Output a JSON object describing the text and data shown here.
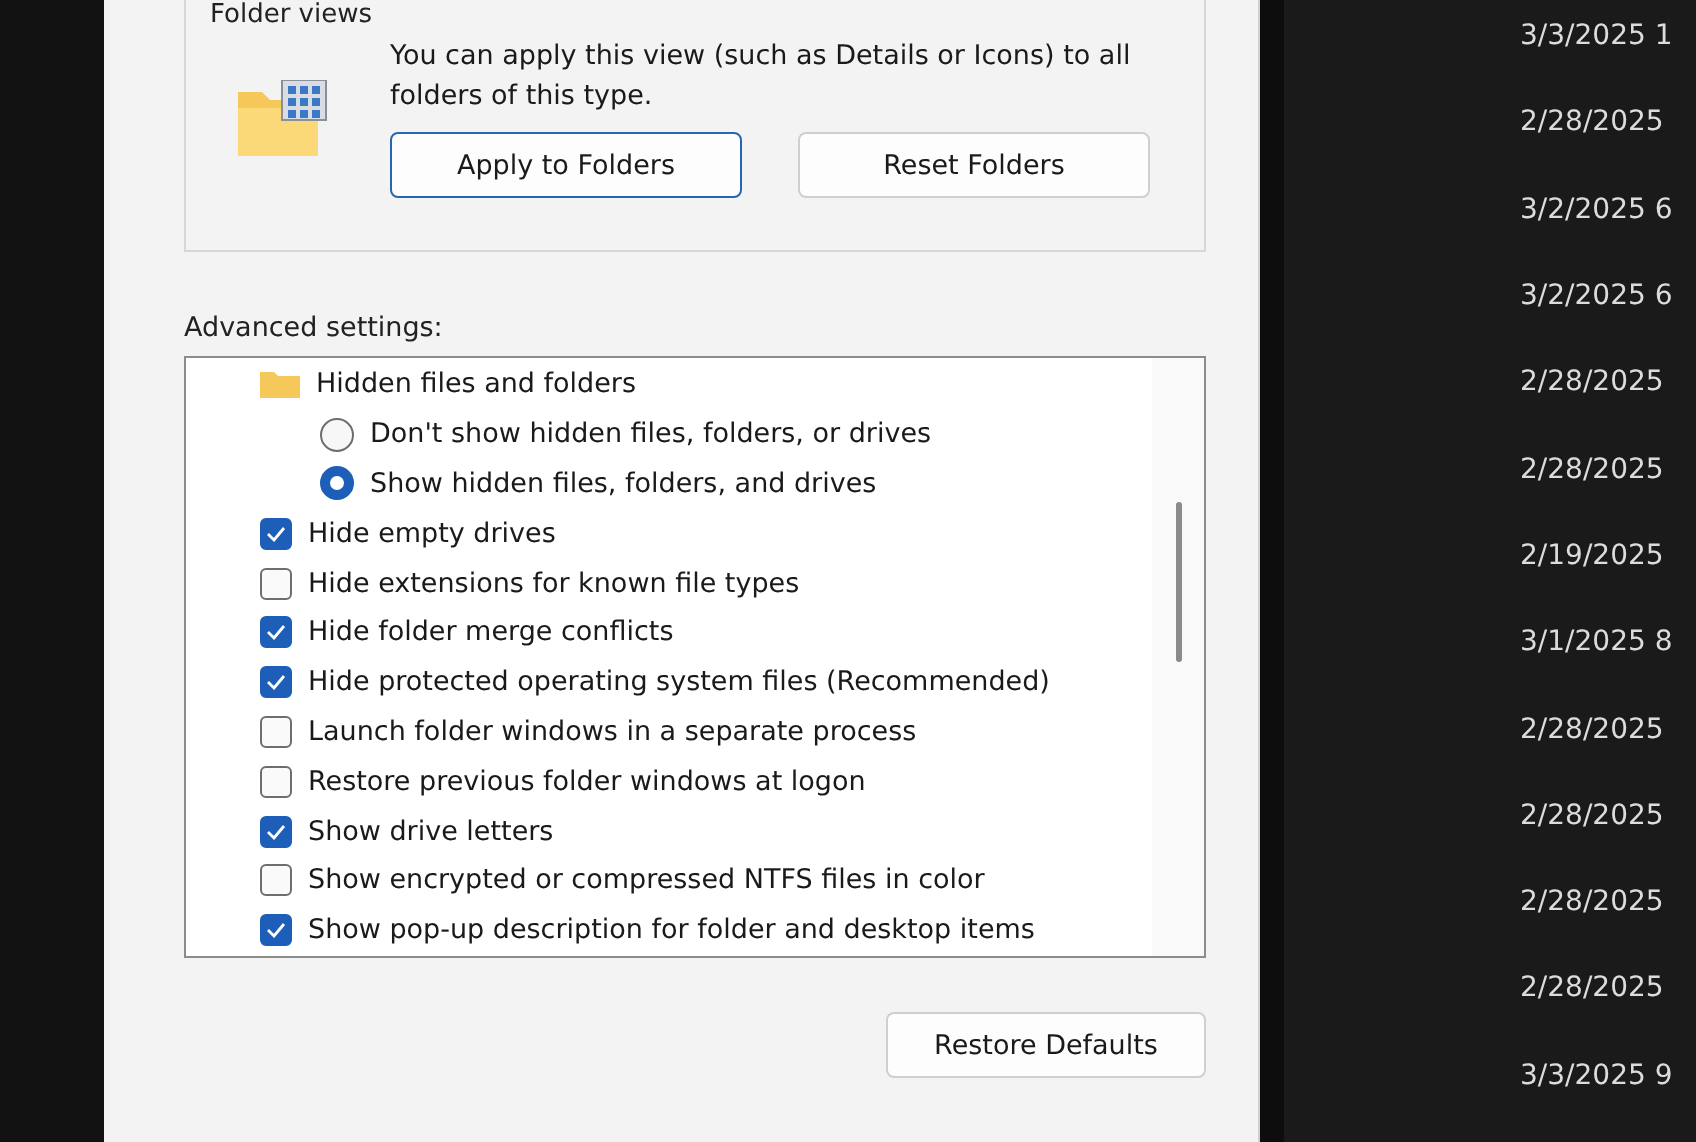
{
  "folder_views": {
    "title": "Folder views",
    "description": "You can apply this view (such as Details or Icons) to all folders of this type.",
    "buttons": [
      {
        "label": "Apply to Folders",
        "focused": true
      },
      {
        "label": "Reset Folders",
        "focused": false
      }
    ]
  },
  "advanced": {
    "label": "Advanced settings:",
    "items": [
      {
        "kind": "folder",
        "label": "Hidden files and folders",
        "children": [
          {
            "kind": "radio",
            "label": "Don't show hidden files, folders, or drives",
            "selected": false
          },
          {
            "kind": "radio",
            "label": "Show hidden files, folders, and drives",
            "selected": true
          }
        ]
      },
      {
        "kind": "checkbox",
        "label": "Hide empty drives",
        "checked": true
      },
      {
        "kind": "checkbox",
        "label": "Hide extensions for known file types",
        "checked": false
      },
      {
        "kind": "checkbox",
        "label": "Hide folder merge conflicts",
        "checked": true
      },
      {
        "kind": "checkbox",
        "label": "Hide protected operating system files (Recommended)",
        "checked": true
      },
      {
        "kind": "checkbox",
        "label": "Launch folder windows in a separate process",
        "checked": false
      },
      {
        "kind": "checkbox",
        "label": "Restore previous folder windows at logon",
        "checked": false
      },
      {
        "kind": "checkbox",
        "label": "Show drive letters",
        "checked": true
      },
      {
        "kind": "checkbox",
        "label": "Show encrypted or compressed NTFS files in color",
        "checked": false
      },
      {
        "kind": "checkbox",
        "label": "Show pop-up description for folder and desktop items",
        "checked": true
      }
    ]
  },
  "restore_button": "Restore Defaults",
  "file_dates": [
    "3/3/2025 1",
    "2/28/2025",
    "3/2/2025 6",
    "3/2/2025 6",
    "2/28/2025",
    "2/28/2025",
    "2/19/2025",
    "3/1/2025 8",
    "2/28/2025",
    "2/28/2025",
    "2/28/2025",
    "2/28/2025",
    "3/3/2025 9"
  ]
}
